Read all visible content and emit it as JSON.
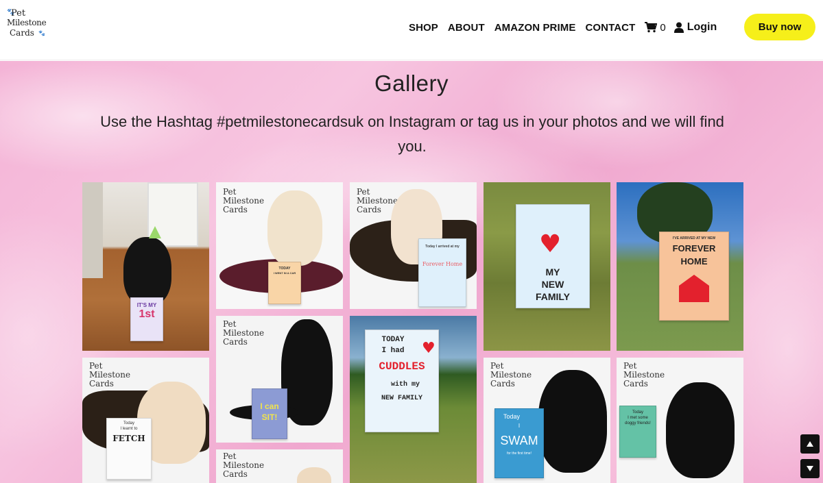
{
  "header": {
    "logo": {
      "line1": "Pet",
      "line2": "Milestone",
      "line3": "Cards"
    },
    "nav": [
      "SHOP",
      "ABOUT",
      "AMAZON PRIME",
      "CONTACT"
    ],
    "cart_count": "0",
    "login_label": "Login",
    "buy_label": "Buy now"
  },
  "gallery": {
    "title": "Gallery",
    "subtitle": "Use the Hashtag #petmilestonecardsuk on Instagram or tag us in your photos and we will find you."
  },
  "watermark": {
    "line1": "Pet",
    "line2": "Milestone",
    "line3": "Cards"
  },
  "cards": {
    "first_birthday": {
      "line1": "IT'S MY",
      "line2": "1st"
    },
    "went_in_car": {
      "line1": "TODAY",
      "line2": "I WENT IN A CAR"
    },
    "forever_home_1": {
      "line1": "Today I arrived at my",
      "line2": "Forever Home"
    },
    "new_family": {
      "line1": "MY",
      "line2": "NEW",
      "line3": "FAMILY"
    },
    "forever_home_2": {
      "line1": "I'VE ARRIVED AT MY NEW",
      "line2": "FOREVER",
      "line3": "HOME"
    },
    "can_sit": {
      "line1": "I can",
      "line2": "SIT!"
    },
    "cuddles": {
      "line1": "TODAY",
      "line2": "I had",
      "line3": "CUDDLES",
      "line4": "with my",
      "line5": "NEW FAMILY"
    },
    "fetch": {
      "line1": "Today",
      "line2": "I learnt to",
      "line3": "FETCH"
    },
    "swam": {
      "line1": "Today",
      "line2": "I",
      "line3": "SWAM",
      "line4": "for the first time!"
    },
    "doggy_friends": {
      "line1": "Today",
      "line2": "I met some",
      "line3": "doggy friends!"
    }
  },
  "colors": {
    "accent": "#f6ef1a",
    "pink": "#f4b3d6",
    "heart": "#e3212d"
  },
  "icons": [
    "cart-icon",
    "user-icon",
    "paw-icon",
    "heart-icon",
    "chevron-up-icon",
    "chevron-down-icon"
  ]
}
